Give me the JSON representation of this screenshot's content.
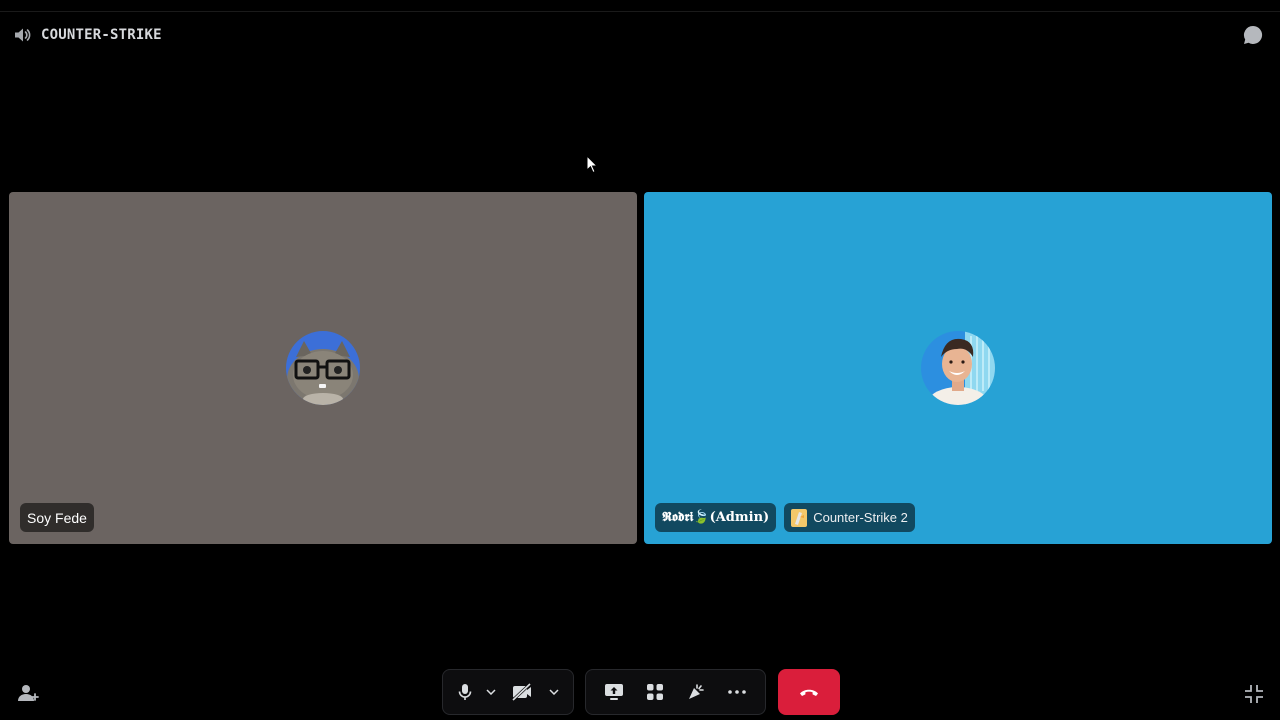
{
  "header": {
    "channel_name": "COUNTER-STRIKE",
    "channel_icon": "speaker-icon",
    "chat_icon": "chat-bubble-icon"
  },
  "tiles": [
    {
      "name": "Soy Fede",
      "background": "#6b6461",
      "avatar": "cat-with-glasses-avatar"
    },
    {
      "name": "𝕽𝖔𝖉𝖗𝖎🍃(Admin)",
      "background": "#27a2d5",
      "avatar": "smiling-man-avatar",
      "activity": "Counter-Strike 2"
    }
  ],
  "controls": {
    "mic_icon": "microphone-icon",
    "camera_icon": "camera-off-icon",
    "share_icon": "screen-share-icon",
    "activities_icon": "activities-icon",
    "soundboard_icon": "soundboard-icon",
    "more_icon": "more-options-icon",
    "hangup_icon": "hang-up-icon",
    "hangup_color": "#da1e3b"
  },
  "corner": {
    "invite_icon": "add-friend-icon",
    "fullscreen_icon": "exit-fullscreen-icon"
  }
}
